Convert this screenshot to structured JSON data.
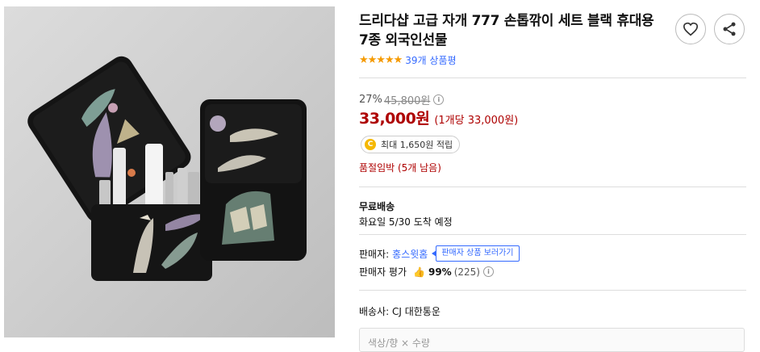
{
  "product": {
    "title": "드리다샵 고급 자개 777 손톱깎이 세트 블랙 휴대용 7종 외국인선물",
    "image_alt": "자개 손톱깎이 세트 케이스 사진"
  },
  "actions": {
    "wishlist_icon": "heart-icon",
    "share_icon": "share-icon"
  },
  "rating": {
    "stars": "★★★★★",
    "review_count_text": "39개 상품평"
  },
  "price": {
    "discount_rate": "27%",
    "original_price": "45,800원",
    "sale_price": "33,000원",
    "unit_price": "(1개당 33,000원)",
    "info_icon_glyph": "i"
  },
  "reward": {
    "coin_glyph": "C",
    "text": "최대 1,650원 적립"
  },
  "stock": {
    "text": "품절임박 (5개 남음)"
  },
  "shipping": {
    "title": "무료배송",
    "delivery_date": "화요일 5/30 도착 예정"
  },
  "seller": {
    "label": "판매자:",
    "name": "홍스윗홈",
    "tooltip": "판매자 상품 보러가기",
    "rating_label": "판매자 평가",
    "thumb_glyph": "👍",
    "rating_percent": "99%",
    "rating_count": "(225)"
  },
  "courier": {
    "text": "배송사: CJ 대한통운"
  },
  "option": {
    "partial_text": "색상/향 × 수량"
  },
  "colors": {
    "price_red": "#ae0000",
    "link_blue": "#346aff",
    "star_orange": "#f59a00"
  }
}
